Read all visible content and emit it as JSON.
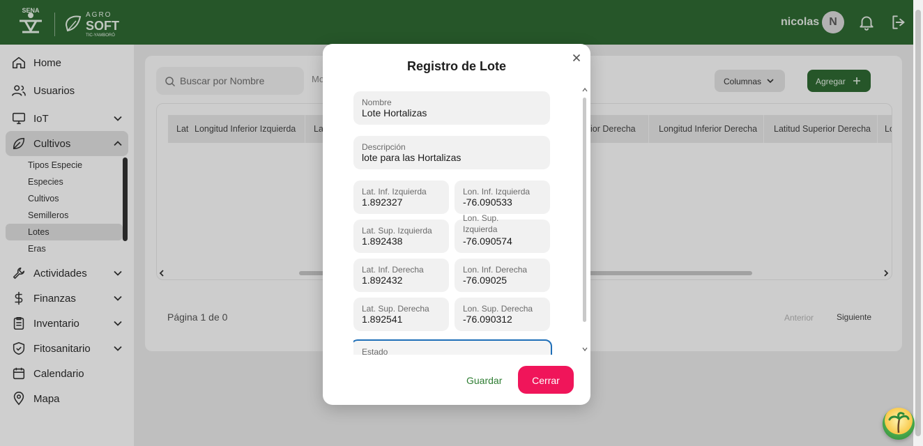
{
  "header": {
    "logo_sena": "SENA",
    "logo_agro": "AGRO",
    "logo_soft": "SOFT",
    "logo_sub": "TIC-YAMBORÓ",
    "user_name": "nicolas",
    "avatar_initial": "N",
    "notification_icon": "bell-icon",
    "logout_icon": "logout-icon"
  },
  "sidebar": {
    "items": [
      {
        "label": "Home",
        "icon": "home-icon"
      },
      {
        "label": "Usuarios",
        "icon": "users-icon"
      },
      {
        "label": "IoT",
        "icon": "monitor-icon"
      },
      {
        "label": "Cultivos",
        "icon": "leaf-icon"
      },
      {
        "label": "Actividades",
        "icon": "wrench-icon"
      },
      {
        "label": "Finanzas",
        "icon": "dollar-icon"
      },
      {
        "label": "Inventario",
        "icon": "clipboard-icon"
      },
      {
        "label": "Fitosanitario",
        "icon": "shield-icon"
      },
      {
        "label": "Calendario",
        "icon": "calendar-icon"
      },
      {
        "label": "Mapa",
        "icon": "map-pin-icon"
      }
    ],
    "cultivos_sub": [
      "Tipos Especie",
      "Especies",
      "Cultivos",
      "Semilleros",
      "Lotes",
      "Eras"
    ]
  },
  "main": {
    "search_placeholder": "Buscar por Nombre",
    "ghost_text": "Mo",
    "columns_label": "Columnas",
    "add_label": "Agregar",
    "table_headers": [
      "Lat",
      "Longitud Inferior Izquierda",
      "Lat",
      "ior Derecha",
      "Longitud Inferior Derecha",
      "Latitud Superior Derecha",
      "Lo"
    ],
    "page_info": "Página 1 de 0",
    "prev_label": "Anterior",
    "next_label": "Siguiente"
  },
  "modal": {
    "title": "Registro de Lote",
    "fields": {
      "nombre": {
        "label": "Nombre",
        "value": "Lote Hortalizas"
      },
      "descripcion": {
        "label": "Descripción",
        "value": "lote para las Hortalizas"
      },
      "lat_inf_izq": {
        "label": "Lat. Inf. Izquierda",
        "value": "1.892327"
      },
      "lon_inf_izq": {
        "label": "Lon. Inf. Izquierda",
        "value": "-76.090533"
      },
      "lat_sup_izq": {
        "label": "Lat. Sup. Izquierda",
        "value": "1.892438"
      },
      "lon_sup_izq": {
        "label": "Lon. Sup. Izquierda",
        "value": "-76.090574"
      },
      "lat_inf_der": {
        "label": "Lat. Inf. Derecha",
        "value": "1.892432"
      },
      "lon_inf_der": {
        "label": "Lon. Inf. Derecha",
        "value": "-76.09025"
      },
      "lat_sup_der": {
        "label": "Lat. Sup. Derecha",
        "value": "1.892541"
      },
      "lon_sup_der": {
        "label": "Lon. Sup. Derecha",
        "value": "-76.090312"
      },
      "estado": {
        "label": "Estado",
        "value": ""
      }
    },
    "save_label": "Guardar",
    "close_label": "Cerrar"
  },
  "colors": {
    "brand_green": "#2f6a33",
    "accent_pink": "#f0155a",
    "focus_blue": "#1f6fb8"
  }
}
